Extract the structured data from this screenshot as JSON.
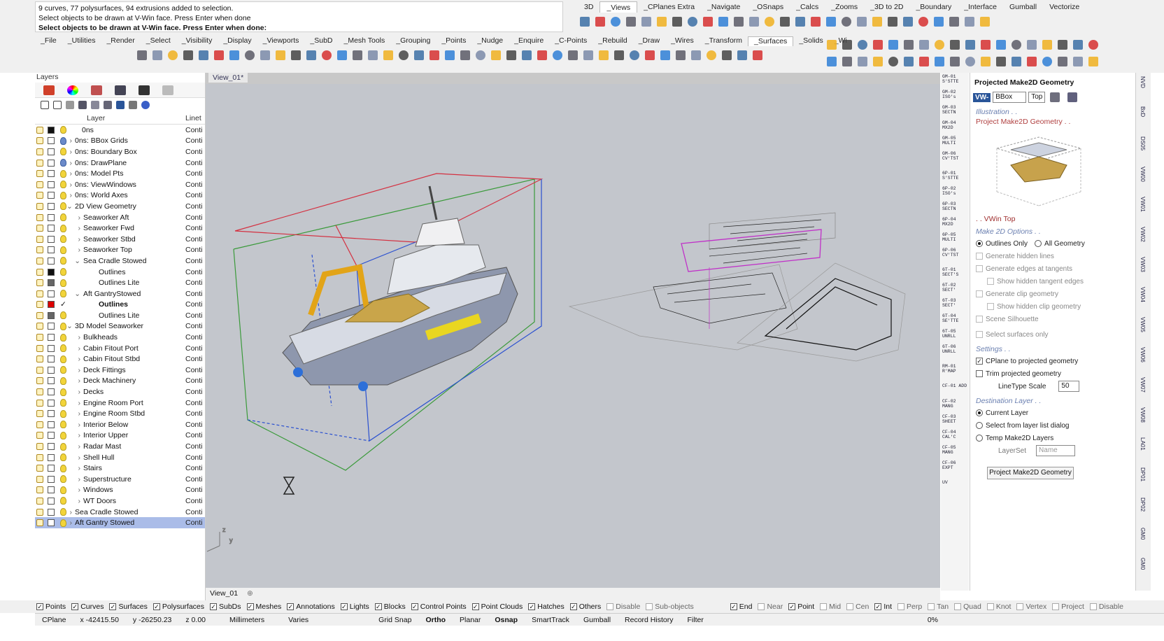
{
  "command": {
    "history": [
      "9 curves, 77 polysurfaces, 94 extrusions added to selection.",
      "Select objects to be drawn at V-Win face. Press Enter when done"
    ],
    "prompt": "Select objects to be drawn at V-Win face. Press Enter when done:"
  },
  "workbench_tabs": [
    "3D",
    "_Views",
    "_CPlanes Extra",
    "_Navigate",
    "_OSnaps",
    "_Calcs",
    "_Zooms",
    "_3D to 2D",
    "_Boundary",
    "_Interface",
    "Gumball",
    "Vectorize"
  ],
  "main_tabs": [
    "_File",
    "_Utilities",
    "_Render",
    "_Select",
    "_Visibility",
    "_Display",
    "_Viewports",
    "_SubD",
    "_Mesh Tools",
    "_Grouping",
    "_Points",
    "_Nudge",
    "_Enquire",
    "_C-Points",
    "_Rebuild",
    "_Draw",
    "_Wires",
    "_Transform",
    "_Surfaces",
    "_Solids",
    "_Wi"
  ],
  "layers_panel": {
    "title": "Layers",
    "col_layer": "Layer",
    "col_linetype": "Linet",
    "rows": [
      {
        "name": "0ns",
        "lt": "Conti",
        "indent": 0,
        "exp": "",
        "color": "#111"
      },
      {
        "name": "0ns: BBox Grids",
        "lt": "Conti",
        "indent": 0,
        "exp": ">",
        "color": "#fff"
      },
      {
        "name": "0ns: Boundary Box",
        "lt": "Conti",
        "indent": 0,
        "exp": ">",
        "color": "#fff"
      },
      {
        "name": "0ns: DrawPlane",
        "lt": "Conti",
        "indent": 0,
        "exp": ">",
        "color": "#fff"
      },
      {
        "name": "0ns: Model Pts",
        "lt": "Conti",
        "indent": 0,
        "exp": ">",
        "color": "#fff"
      },
      {
        "name": "0ns: ViewWindows",
        "lt": "Conti",
        "indent": 0,
        "exp": ">",
        "color": "#fff"
      },
      {
        "name": "0ns: World Axes",
        "lt": "Conti",
        "indent": 0,
        "exp": ">",
        "color": "#fff"
      },
      {
        "name": "2D View Geometry",
        "lt": "Conti",
        "indent": 0,
        "exp": "v",
        "color": "#fff"
      },
      {
        "name": "Seaworker Aft",
        "lt": "Conti",
        "indent": 1,
        "exp": ">",
        "color": "#fff"
      },
      {
        "name": "Seaworker Fwd",
        "lt": "Conti",
        "indent": 1,
        "exp": ">",
        "color": "#fff"
      },
      {
        "name": "Seaworker Stbd",
        "lt": "Conti",
        "indent": 1,
        "exp": ">",
        "color": "#fff"
      },
      {
        "name": "Seaworker Top",
        "lt": "Conti",
        "indent": 1,
        "exp": ">",
        "color": "#fff"
      },
      {
        "name": "Sea Cradle Stowed",
        "lt": "Conti",
        "indent": 1,
        "exp": "v",
        "color": "#fff"
      },
      {
        "name": "Outlines",
        "lt": "Conti",
        "indent": 2,
        "exp": "",
        "color": "#111"
      },
      {
        "name": "Outlines Lite",
        "lt": "Conti",
        "indent": 2,
        "exp": "",
        "color": "#666"
      },
      {
        "name": "Aft GantryStowed",
        "lt": "Conti",
        "indent": 1,
        "exp": "v",
        "color": "#fff"
      },
      {
        "name": "Outlines",
        "lt": "Conti",
        "indent": 2,
        "exp": "",
        "color": "#d00"
      },
      {
        "name": "Outlines Lite",
        "lt": "Conti",
        "indent": 2,
        "exp": "",
        "color": "#666"
      },
      {
        "name": "3D Model Seaworker",
        "lt": "Conti",
        "indent": 0,
        "exp": "v",
        "color": "#fff"
      },
      {
        "name": "Bulkheads",
        "lt": "Conti",
        "indent": 1,
        "exp": ">",
        "color": "#fff"
      },
      {
        "name": "Cabin Fitout Port",
        "lt": "Conti",
        "indent": 1,
        "exp": ">",
        "color": "#fff"
      },
      {
        "name": "Cabin Fitout Stbd",
        "lt": "Conti",
        "indent": 1,
        "exp": ">",
        "color": "#fff"
      },
      {
        "name": "Deck Fittings",
        "lt": "Conti",
        "indent": 1,
        "exp": ">",
        "color": "#fff"
      },
      {
        "name": "Deck Machinery",
        "lt": "Conti",
        "indent": 1,
        "exp": ">",
        "color": "#fff"
      },
      {
        "name": "Decks",
        "lt": "Conti",
        "indent": 1,
        "exp": ">",
        "color": "#fff"
      },
      {
        "name": "Engine Room Port",
        "lt": "Conti",
        "indent": 1,
        "exp": ">",
        "color": "#fff"
      },
      {
        "name": "Engine Room Stbd",
        "lt": "Conti",
        "indent": 1,
        "exp": ">",
        "color": "#fff"
      },
      {
        "name": "Interior Below",
        "lt": "Conti",
        "indent": 1,
        "exp": ">",
        "color": "#fff"
      },
      {
        "name": "Interior Upper",
        "lt": "Conti",
        "indent": 1,
        "exp": ">",
        "color": "#fff"
      },
      {
        "name": "Radar Mast",
        "lt": "Conti",
        "indent": 1,
        "exp": ">",
        "color": "#fff"
      },
      {
        "name": "Shell Hull",
        "lt": "Conti",
        "indent": 1,
        "exp": ">",
        "color": "#fff"
      },
      {
        "name": "Stairs",
        "lt": "Conti",
        "indent": 1,
        "exp": ">",
        "color": "#fff"
      },
      {
        "name": "Superstructure",
        "lt": "Conti",
        "indent": 1,
        "exp": ">",
        "color": "#fff"
      },
      {
        "name": "Windows",
        "lt": "Conti",
        "indent": 1,
        "exp": ">",
        "color": "#fff"
      },
      {
        "name": "WT Doors",
        "lt": "Conti",
        "indent": 1,
        "exp": ">",
        "color": "#fff"
      },
      {
        "name": "Sea Cradle Stowed",
        "lt": "Conti",
        "indent": 0,
        "exp": ">",
        "color": "#fff"
      },
      {
        "name": "Aft Gantry Stowed",
        "lt": "Conti",
        "indent": 0,
        "exp": ">",
        "color": "#fff"
      }
    ],
    "current_index": 16,
    "selected_index": 36
  },
  "viewport": {
    "title": "View_01*",
    "bottom_tab": "View_01",
    "axis_z": "z",
    "axis_y": "y"
  },
  "mid_strip": [
    "GM-01 S'STTE",
    "GM-02 ISO's",
    "GM-03 SECTN",
    "GM-04 MX2D",
    "GM-05 MULTI",
    "GM-06 CV'TST",
    "6P-01 S'STTE",
    "6P-02 ISO's",
    "6P-03 SECTN",
    "6P-04 MX2D",
    "6P-05 MULTI",
    "6P-06 CV'TST",
    "6T-01 SECT'S",
    "6T-02 SECT'",
    "6T-03 SECT'",
    "6T-04 SE'TTE",
    "6T-05 UNRLL",
    "6T-06 UNRLL",
    "RM-01 R'MAP",
    "CF-01 ADD",
    "CF-02 MANG",
    "CF-03 SHEET",
    "CF-04 CAL'C",
    "CF-05 MANG",
    "CF-06 EXPT",
    "UV"
  ],
  "make2d_panel": {
    "title": "Projected Make2D Geometry",
    "vw": "VW-",
    "bbox": "BBox",
    "top": "Top",
    "illustration": "Illustration . .",
    "project_title": "Project Make2D Geometry . .",
    "vwin": ". . VWin Top",
    "options_title": "Make 2D Options . .",
    "outlines_only": "Outlines Only",
    "all_geometry": "All Geometry",
    "hidden_lines": "Generate hidden lines",
    "edges_tangents": "Generate edges at tangents",
    "show_hidden_tangent": "Show hidden tangent edges",
    "clip_geometry": "Generate clip geometry",
    "show_hidden_clip": "Show hidden clip geometry",
    "scene_silhouette": "Scene Silhouette",
    "select_surfaces": "Select surfaces only",
    "settings_title": "Settings . .",
    "cplane_projected": "CPlane to projected geometry",
    "trim_projected": "Trim projected geometry",
    "linetype_label": "LineType Scale",
    "linetype_value": "50",
    "dest_title": "Destination Layer . .",
    "current_layer": "Current Layer",
    "select_from_list": "Select from layer list dialog",
    "temp_layers": "Temp Make2D Layers",
    "layerset_label": "LayerSet",
    "layerset_placeholder": "Name",
    "button": "Project Make2D Geometry"
  },
  "right_strip": [
    "NVD",
    "BxD",
    "DS05",
    "VW00",
    "VW01",
    "VW02",
    "VW03",
    "VW04",
    "VW05",
    "VW06",
    "VW07",
    "VW08",
    "LA01",
    "DP01",
    "DP02",
    "GM0",
    "GM0"
  ],
  "osnap": {
    "filters": [
      {
        "label": "Points",
        "on": true
      },
      {
        "label": "Curves",
        "on": true
      },
      {
        "label": "Surfaces",
        "on": true
      },
      {
        "label": "Polysurfaces",
        "on": true
      },
      {
        "label": "SubDs",
        "on": true
      },
      {
        "label": "Meshes",
        "on": true
      },
      {
        "label": "Annotations",
        "on": true
      },
      {
        "label": "Lights",
        "on": true
      },
      {
        "label": "Blocks",
        "on": true
      },
      {
        "label": "Control Points",
        "on": true
      },
      {
        "label": "Point Clouds",
        "on": true
      },
      {
        "label": "Hatches",
        "on": true
      },
      {
        "label": "Others",
        "on": true
      },
      {
        "label": "Disable",
        "on": false
      },
      {
        "label": "Sub-objects",
        "on": false
      }
    ],
    "snaps": [
      {
        "label": "End",
        "on": true
      },
      {
        "label": "Near",
        "on": false
      },
      {
        "label": "Point",
        "on": true
      },
      {
        "label": "Mid",
        "on": false
      },
      {
        "label": "Cen",
        "on": false
      },
      {
        "label": "Int",
        "on": true
      },
      {
        "label": "Perp",
        "on": false
      },
      {
        "label": "Tan",
        "on": false
      },
      {
        "label": "Quad",
        "on": false
      },
      {
        "label": "Knot",
        "on": false
      },
      {
        "label": "Vertex",
        "on": false
      },
      {
        "label": "Project",
        "on": false
      },
      {
        "label": "Disable",
        "on": false
      }
    ]
  },
  "status": {
    "cplane": "CPlane",
    "x": "x -42415.50",
    "y": "y -26250.23",
    "z": "z 0.00",
    "units": "Millimeters",
    "varies": "Varies",
    "grid": "Grid Snap",
    "ortho": "Ortho",
    "planar": "Planar",
    "osnap": "Osnap",
    "smarttrack": "SmartTrack",
    "gumball": "Gumball",
    "record": "Record History",
    "filter": "Filter",
    "pct": "0%"
  },
  "colors": {
    "selection": "#aabce8",
    "viewport_bg": "#c3c6cc",
    "accent": "#2a5599"
  }
}
